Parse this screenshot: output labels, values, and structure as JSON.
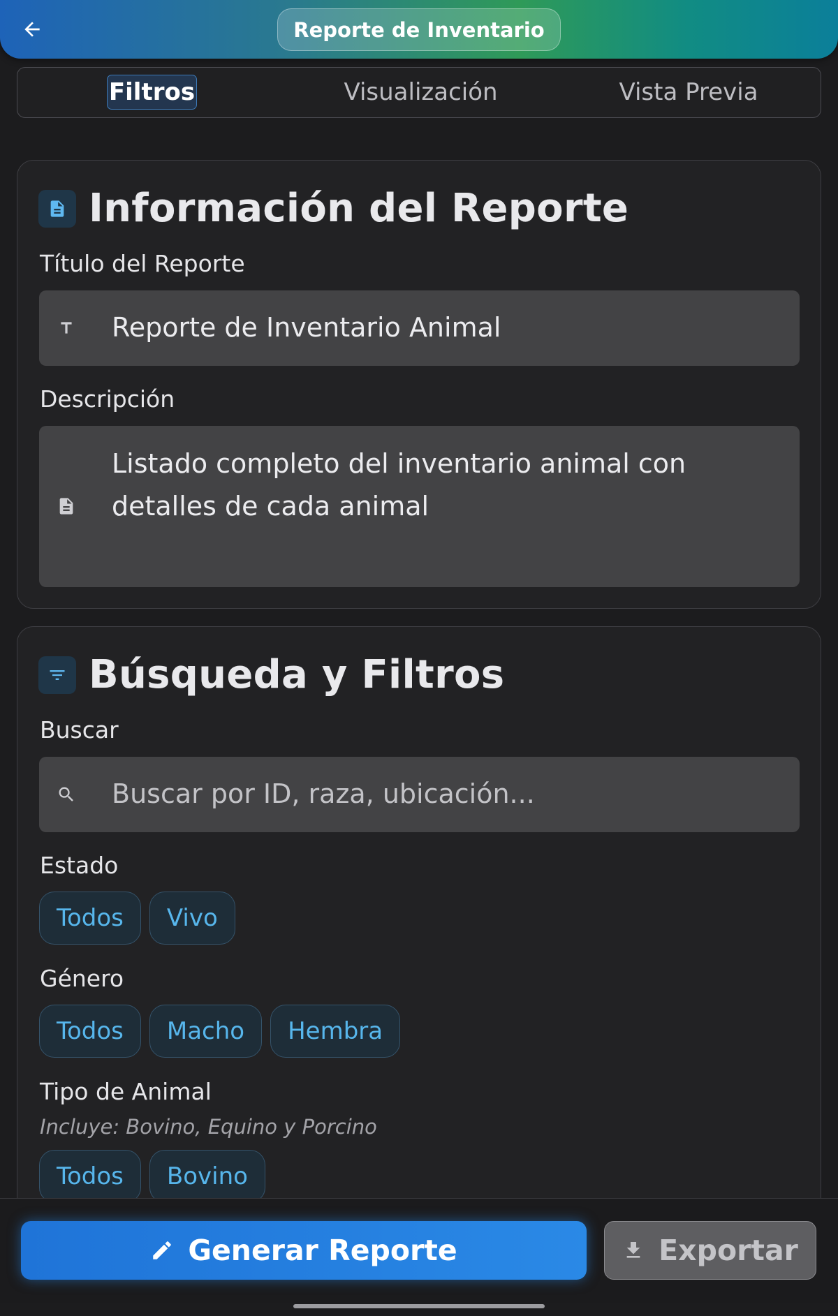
{
  "appbar": {
    "title": "Reporte de Inventario",
    "back_icon": "arrow-left-icon"
  },
  "tabs": [
    {
      "label": "Filtros",
      "active": true
    },
    {
      "label": "Visualización",
      "active": false
    },
    {
      "label": "Vista Previa",
      "active": false
    }
  ],
  "report_info": {
    "title": "Información del Reporte",
    "icon": "document-icon",
    "title_label": "Título del Reporte",
    "title_value": "Reporte de Inventario Animal",
    "description_label": "Descripción",
    "description_value": "Listado completo del inventario animal con detalles de cada animal"
  },
  "filters": {
    "title": "Búsqueda y Filtros",
    "icon": "filter-icon",
    "search_label": "Buscar",
    "search_placeholder": "Buscar por ID, raza, ubicación...",
    "estado": {
      "label": "Estado",
      "options": [
        "Todos",
        "Vivo"
      ]
    },
    "genero": {
      "label": "Género",
      "options": [
        "Todos",
        "Macho",
        "Hembra"
      ]
    },
    "tipo": {
      "label": "Tipo de Animal",
      "hint": "Incluye: Bovino, Equino y Porcino",
      "options": [
        "Todos",
        "Bovino"
      ]
    }
  },
  "actions": {
    "generate": "Generar Reporte",
    "export": "Exportar"
  },
  "colors": {
    "accent": "#2a89e6",
    "chip_text": "#57b6ec",
    "background": "#1c1c1e"
  }
}
